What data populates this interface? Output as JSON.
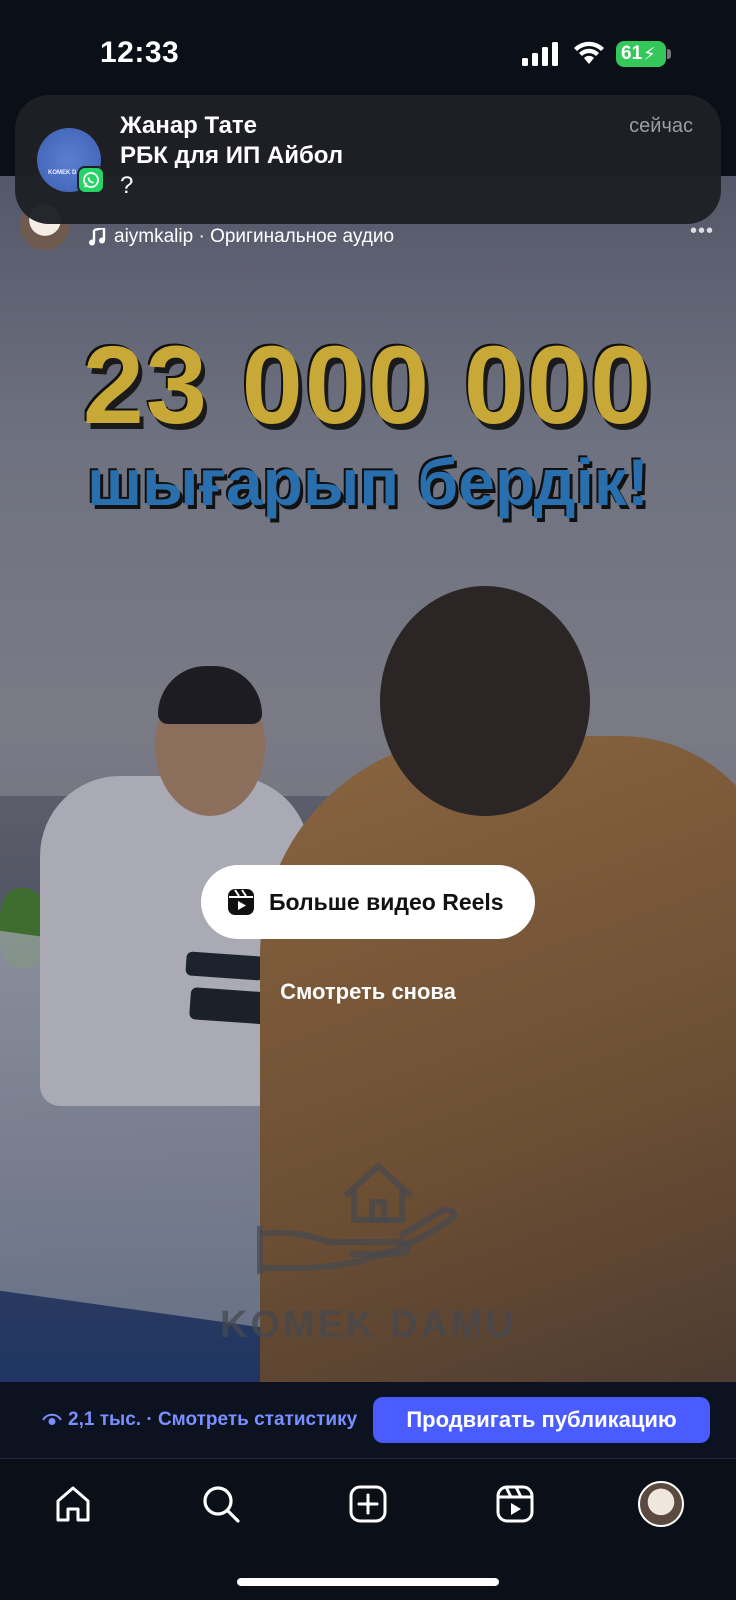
{
  "status_bar": {
    "time": "12:33",
    "battery": "61"
  },
  "notification": {
    "sender": "Жанар Тате",
    "subtitle": "РБК для ИП Айбол",
    "message": "?",
    "time": "сейчас",
    "avatar_text": "KOMEK DAMU",
    "app_icon": "whatsapp-icon"
  },
  "post": {
    "audio": "aiymkalip · Оригинальное аудио"
  },
  "video": {
    "headline_number": "23 000 000",
    "headline_text": "шығарып бердік!",
    "watermark": "KOMEK DAMU",
    "more_reels_label": "Больше видео Reels",
    "replay_label": "Смотреть снова"
  },
  "stats": {
    "views": "2,1 тыс. · Смотреть статистику",
    "promote_label": "Продвигать публикацию"
  },
  "nav": {
    "items": [
      "home-icon",
      "search-icon",
      "create-icon",
      "reels-icon",
      "profile-avatar"
    ]
  },
  "colors": {
    "accent": "#4a5cff",
    "link": "#7a8fff",
    "battery": "#34c759",
    "whatsapp": "#25d366"
  }
}
